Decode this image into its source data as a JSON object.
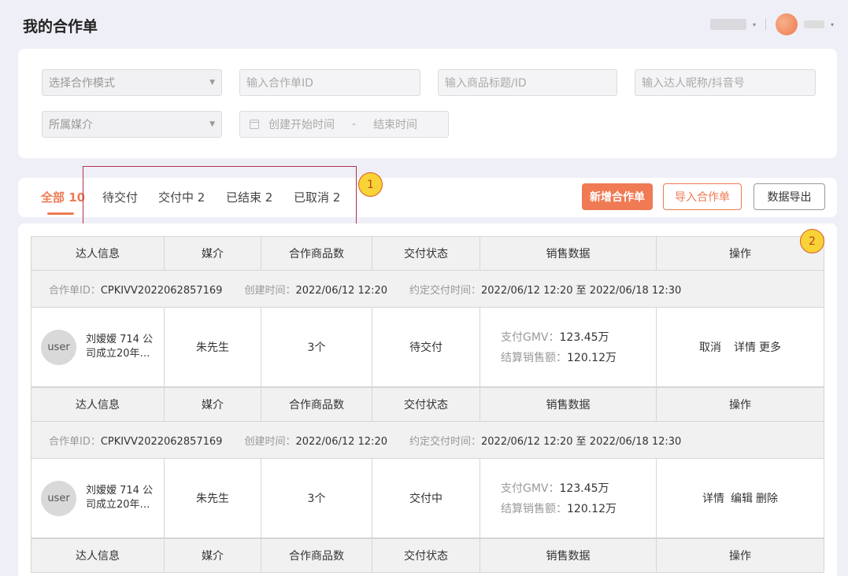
{
  "page": {
    "title": "我的合作单"
  },
  "filters": {
    "mode_placeholder": "选择合作模式",
    "order_id_placeholder": "输入合作单ID",
    "product_placeholder": "输入商品标题/ID",
    "talent_placeholder": "输入达人昵称/抖音号",
    "media_placeholder": "所属媒介",
    "date_start": "创建开始时间",
    "date_sep": "-",
    "date_end": "结束时间"
  },
  "tabs": [
    {
      "label": "全部 10",
      "active": true
    },
    {
      "label": "待交付",
      "active": false
    },
    {
      "label": "交付中 2",
      "active": false
    },
    {
      "label": "已结束 2",
      "active": false
    },
    {
      "label": "已取消 2",
      "active": false
    }
  ],
  "actions": {
    "new_order": "新增合作单",
    "import_order": "导入合作单",
    "export": "数据导出"
  },
  "markers": [
    "1",
    "2"
  ],
  "columns": [
    "达人信息",
    "媒介",
    "合作商品数",
    "交付状态",
    "销售数据",
    "操作"
  ],
  "meta_labels": {
    "order_id": "合作单ID：",
    "created": "创建时间：",
    "delivery": "约定交付时间："
  },
  "orders": [
    {
      "order_id": "CPKIVV2022062857169",
      "created": "2022/06/12 12:20",
      "delivery": "2022/06/12 12:20 至 2022/06/18 12:30",
      "avatar": "user",
      "talent": "刘嫒嫒 714 公司成立20年…",
      "media": "朱先生",
      "product_count": "3个",
      "status": "待交付",
      "gmv_label": "支付GMV：",
      "gmv": "123.45万",
      "settle_label": "结算销售额：",
      "settle": "120.12万",
      "ops": [
        "取消",
        "详情",
        "更多"
      ]
    },
    {
      "order_id": "CPKIVV2022062857169",
      "created": "2022/06/12 12:20",
      "delivery": "2022/06/12 12:20 至 2022/06/18 12:30",
      "avatar": "user",
      "talent": "刘嫒嫒 714 公司成立20年…",
      "media": "朱先生",
      "product_count": "3个",
      "status": "交付中",
      "gmv_label": "支付GMV：",
      "gmv": "123.45万",
      "settle_label": "结算销售额：",
      "settle": "120.12万",
      "ops": [
        "详情",
        "编辑",
        "删除"
      ]
    }
  ]
}
